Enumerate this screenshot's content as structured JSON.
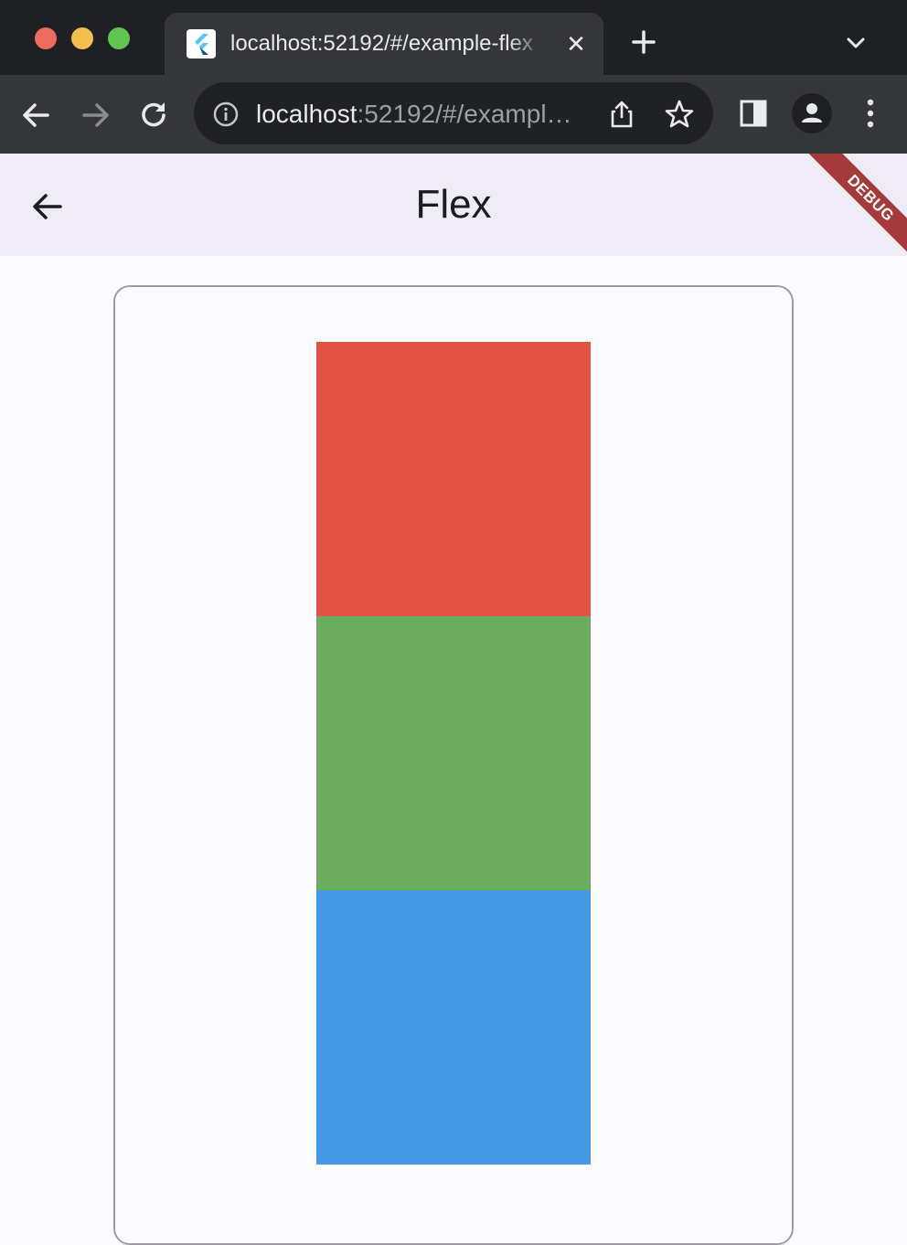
{
  "browser": {
    "tab": {
      "title": "localhost:52192/#/example-flex",
      "close_glyph": "✕"
    },
    "address_bar": {
      "host": "localhost",
      "rest": ":52192/#/exampl…"
    }
  },
  "appbar": {
    "title": "Flex",
    "debug_label": "DEBUG"
  },
  "flex_children": [
    {
      "name": "red-box",
      "color": "#e25345"
    },
    {
      "name": "green-box",
      "color": "#6aab5d"
    },
    {
      "name": "blue-box",
      "color": "#4697e8"
    }
  ],
  "icons": {
    "back": "arrow-left-icon",
    "forward": "arrow-right-icon",
    "reload": "reload-icon",
    "info": "info-icon",
    "share": "share-icon",
    "bookmark": "star-icon",
    "new_tab": "plus-icon",
    "tab_list": "chevron-down-icon",
    "side_panel": "side-panel-icon",
    "profile": "profile-icon",
    "menu": "kebab-menu-icon"
  }
}
